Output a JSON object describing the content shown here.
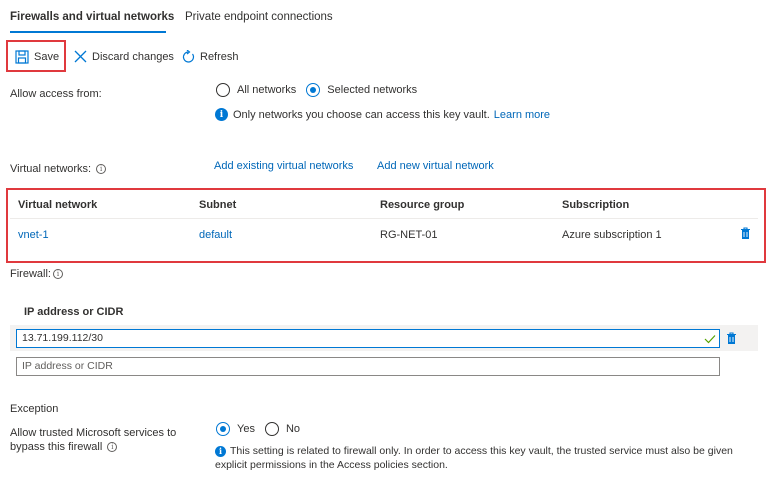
{
  "tabs": {
    "firewalls": "Firewalls and virtual networks",
    "private_endpoints": "Private endpoint connections"
  },
  "toolbar": {
    "save": "Save",
    "discard": "Discard changes",
    "refresh": "Refresh"
  },
  "access": {
    "label": "Allow access from:",
    "option_all": "All networks",
    "option_selected": "Selected networks",
    "selected": "Selected networks",
    "info_text": "Only networks you choose can access this key vault.",
    "learn_more": "Learn more"
  },
  "virtual_networks": {
    "label": "Virtual networks:",
    "add_existing": "Add existing virtual networks",
    "add_new": "Add new virtual network",
    "columns": [
      "Virtual network",
      "Subnet",
      "Resource group",
      "Subscription"
    ],
    "rows": [
      {
        "vnet": "vnet-1",
        "subnet": "default",
        "resource_group": "RG-NET-01",
        "subscription": "Azure subscription 1"
      }
    ]
  },
  "firewall": {
    "label": "Firewall:",
    "column_header": "IP address or CIDR",
    "entries": [
      "13.71.199.112/30"
    ],
    "placeholder": "IP address or CIDR"
  },
  "exception": {
    "heading": "Exception",
    "label_line1": "Allow trusted Microsoft services to",
    "label_line2": "bypass this firewall",
    "option_yes": "Yes",
    "option_no": "No",
    "selected": "Yes",
    "info_line1": "This setting is related to firewall only. In order to access this key vault, the trusted service must also be given",
    "info_line2": "explicit permissions in the Access policies section."
  },
  "colors": {
    "accent": "#0078d4",
    "link": "#0067b8",
    "highlight_box": "#e0393e"
  }
}
